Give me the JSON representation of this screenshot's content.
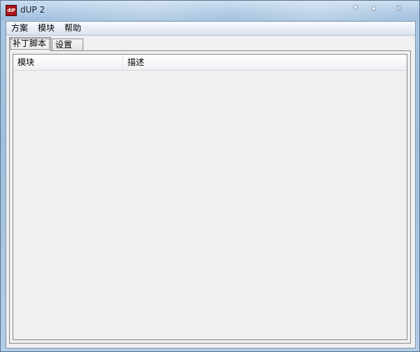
{
  "window": {
    "title": "dUP 2",
    "icon_text": "dUP",
    "controls": {
      "minimize": "▾",
      "maximize": "▴",
      "close": "x"
    }
  },
  "menu": {
    "items": [
      {
        "label": "方案"
      },
      {
        "label": "模块"
      },
      {
        "label": "帮助"
      }
    ]
  },
  "tabs": [
    {
      "label": "补丁脚本",
      "active": true
    },
    {
      "label": "设置",
      "active": false
    }
  ],
  "list": {
    "columns": [
      {
        "label": "模块"
      },
      {
        "label": "描述"
      }
    ],
    "rows": []
  },
  "colors": {
    "title_bar": "#a9c6e2",
    "client_background": "#f0f0f0",
    "icon_background": "#a8151b"
  }
}
